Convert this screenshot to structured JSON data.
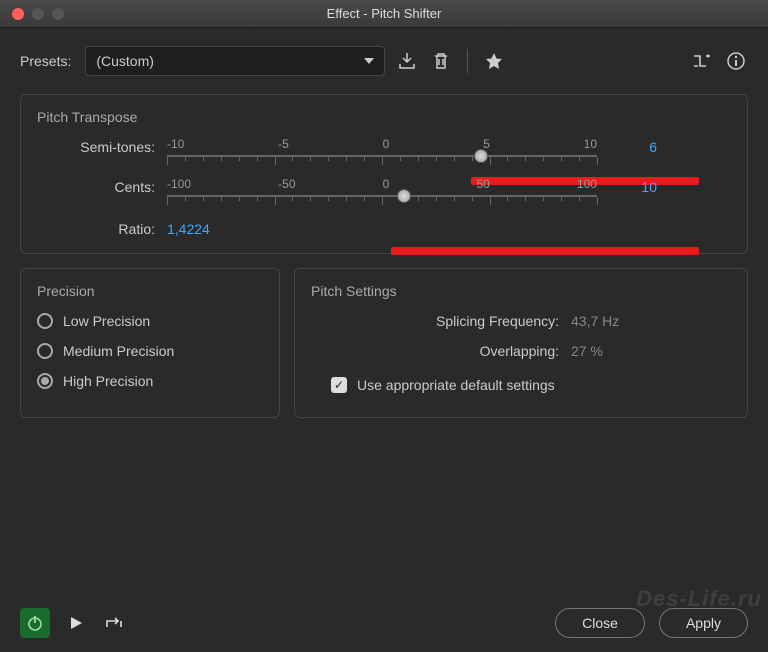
{
  "window": {
    "title": "Effect - Pitch Shifter"
  },
  "presets": {
    "label": "Presets:",
    "value": "(Custom)"
  },
  "transpose": {
    "title": "Pitch Transpose",
    "semitones": {
      "label": "Semi-tones:",
      "ticks": [
        "-10",
        "-5",
        "0",
        "5",
        "10"
      ],
      "value": "6"
    },
    "cents": {
      "label": "Cents:",
      "ticks": [
        "-100",
        "-50",
        "0",
        "50",
        "100"
      ],
      "value": "10"
    },
    "ratio": {
      "label": "Ratio:",
      "value": "1,4224"
    }
  },
  "precision": {
    "title": "Precision",
    "low": "Low Precision",
    "medium": "Medium Precision",
    "high": "High Precision"
  },
  "settings": {
    "title": "Pitch Settings",
    "splicing": {
      "label": "Splicing Frequency:",
      "value": "43,7 Hz"
    },
    "overlap": {
      "label": "Overlapping:",
      "value": "27 %"
    },
    "defaults": "Use appropriate default settings"
  },
  "buttons": {
    "close": "Close",
    "apply": "Apply"
  },
  "watermark": "Des-Life.ru"
}
